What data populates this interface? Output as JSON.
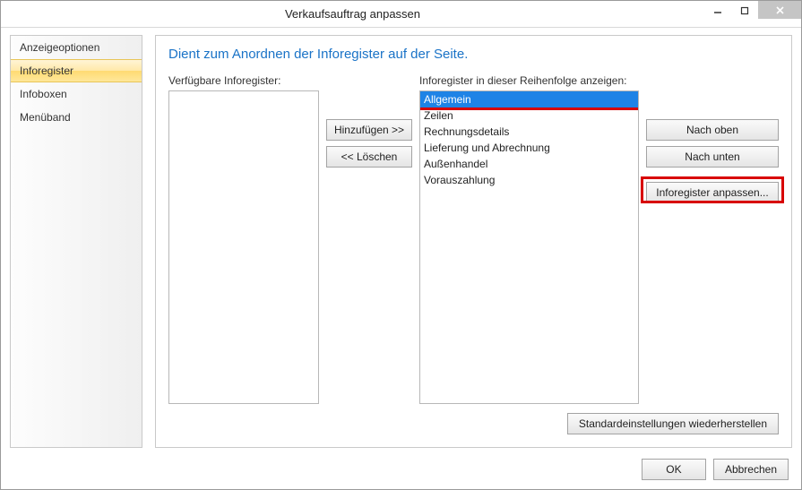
{
  "window": {
    "title": "Verkaufsauftrag anpassen"
  },
  "nav": {
    "items": [
      {
        "label": "Anzeigeoptionen",
        "selected": false
      },
      {
        "label": "Inforegister",
        "selected": true
      },
      {
        "label": "Infoboxen",
        "selected": false
      },
      {
        "label": "Menüband",
        "selected": false
      }
    ]
  },
  "main": {
    "heading": "Dient zum Anordnen der Inforegister auf der Seite.",
    "available_label": "Verfügbare Inforegister:",
    "ordered_label": "Inforegister in dieser Reihenfolge anzeigen:",
    "btn_add": "Hinzufügen >>",
    "btn_remove": "<< Löschen",
    "btn_up": "Nach oben",
    "btn_down": "Nach unten",
    "btn_customize": "Inforegister anpassen...",
    "btn_restore": "Standardeinstellungen wiederherstellen",
    "available_items": [],
    "ordered_items": [
      {
        "label": "Allgemein",
        "selected": true
      },
      {
        "label": "Zeilen",
        "selected": false
      },
      {
        "label": "Rechnungsdetails",
        "selected": false
      },
      {
        "label": "Lieferung und Abrechnung",
        "selected": false
      },
      {
        "label": "Außenhandel",
        "selected": false
      },
      {
        "label": "Vorauszahlung",
        "selected": false
      }
    ]
  },
  "dialog": {
    "ok": "OK",
    "cancel": "Abbrechen"
  }
}
